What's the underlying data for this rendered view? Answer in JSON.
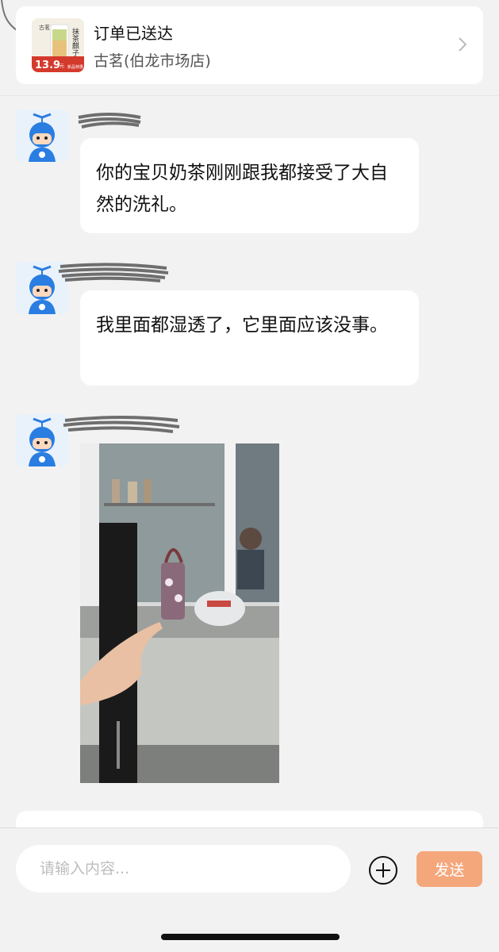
{
  "order": {
    "title": "订单已送达",
    "shop": "古茗(伯龙市场店)",
    "thumb": {
      "brand": "古茗",
      "label": "抹茶麒子冻",
      "price": "13.9",
      "price_unit": "元",
      "badge": "新品特惠"
    }
  },
  "messages": [
    {
      "text": "你的宝贝奶茶刚刚跟我都接受了大自然的洗礼。"
    },
    {
      "text": "我里面都湿透了，它里面应该没事。"
    },
    {
      "image": "photo-of-delivered-drink"
    }
  ],
  "composer": {
    "placeholder": "请输入内容...",
    "send_label": "发送"
  },
  "colors": {
    "send_button": "#f5a77c",
    "avatar_blue": "#2a7de1"
  }
}
